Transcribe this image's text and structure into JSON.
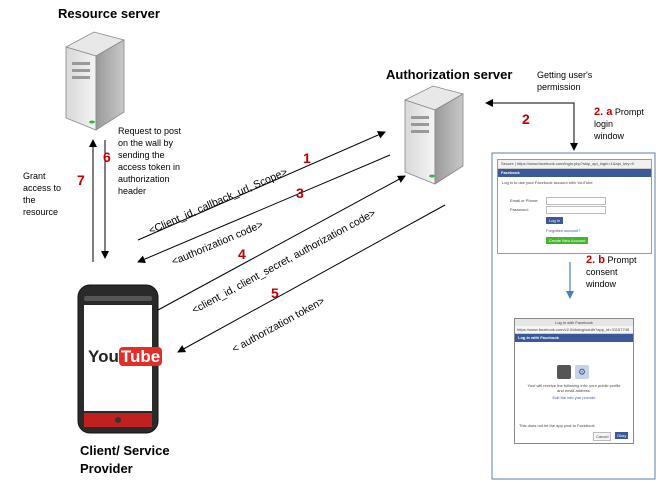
{
  "resource_server": {
    "title": "Resource server"
  },
  "auth_server": {
    "title": "Authorization server"
  },
  "client": {
    "title_line1": "Client/ Service",
    "title_line2": "Provider",
    "app_logo_left": "You",
    "app_logo_right": "Tube"
  },
  "notes": {
    "getting_permission": [
      "Getting user's",
      "permission"
    ],
    "request_post": [
      "Request to post",
      "on the wall by",
      "sending the",
      "access token in",
      "authorization",
      "header"
    ],
    "grant": [
      "Grant",
      "access to",
      "the",
      "resource"
    ]
  },
  "steps": {
    "s1": "1",
    "s2": "2",
    "s3": "3",
    "s4": "4",
    "s5": "5",
    "s6": "6",
    "s7": "7",
    "s2a_num": "2. a",
    "s2a_text": [
      "Prompt",
      "login",
      "window"
    ],
    "s2b_num": "2. b",
    "s2b_text": [
      "Prompt",
      "consent",
      "window"
    ]
  },
  "arrow_labels": {
    "l1": "<Client_id, callback_url, Scope>",
    "l3": "<authorization code>",
    "l4": "<client_id, client_secret, authorization code>",
    "l5": "< authorization token>"
  },
  "login_window": {
    "url": "Secure | https://www.facebook.com/login.php?skip_api_login=1&api_key=9",
    "brand": "Facebook",
    "prompt": "Log in to use your Facebook account with YouTube",
    "email_label": "Email or Phone:",
    "password_label": "Password:",
    "login_button": "Log In",
    "forgot": "Forgotten account?",
    "create_button": "Create New Account"
  },
  "consent_window": {
    "title": "Log in with Facebook",
    "url": "https://www.facebook.com/v2.0/dialog/oauth?app_id=31157745",
    "header": "Log in with Facebook",
    "body": "Yoof will receive the following info: your public profile and email address.",
    "edit_link": "Edit the info you provide",
    "footer": "This does not let the app post to Facebook",
    "cancel": "Cancel",
    "continue": "Okay"
  },
  "colors": {
    "step_red": "#c00000",
    "consent_arrow": "#4a7ebb",
    "fb_blue": "#3b5998",
    "fb_green": "#42b72a",
    "youtube_red": "#e52d27"
  }
}
